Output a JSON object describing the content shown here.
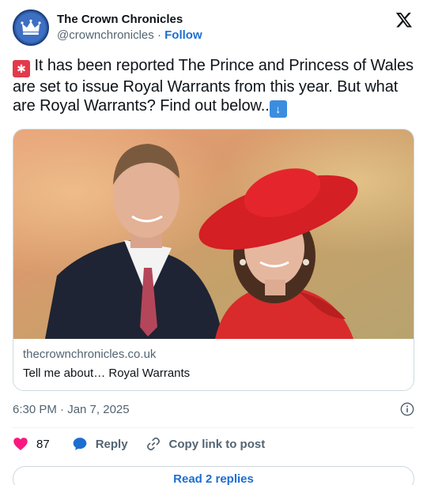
{
  "author": {
    "display_name": "The Crown Chronicles",
    "handle": "@crownchronicles",
    "separator": " · ",
    "follow_label": "Follow",
    "avatar_icon": "crown-icon"
  },
  "brand_icon": "x-logo-icon",
  "tweet": {
    "emoji_start": "siren-emoji",
    "text": "It has been reported The Prince and Princess of Wales are set to issue Royal Warrants from this year. But what are Royal Warrants? Find out below..",
    "emoji_end": "down-arrow-emoji"
  },
  "card": {
    "image": "photo-prince-and-princess-of-wales",
    "domain": "thecrownchronicles.co.uk",
    "title": "Tell me about… Royal Warrants"
  },
  "timestamp": "6:30 PM · Jan 7, 2025",
  "actions": {
    "like_count": "87",
    "reply_label": "Reply",
    "copy_label": "Copy link to post"
  },
  "replies_button": "Read 2 replies",
  "colors": {
    "accent": "#1d6ed1",
    "like": "#f91880",
    "muted": "#536471",
    "border": "#cfd9de"
  }
}
